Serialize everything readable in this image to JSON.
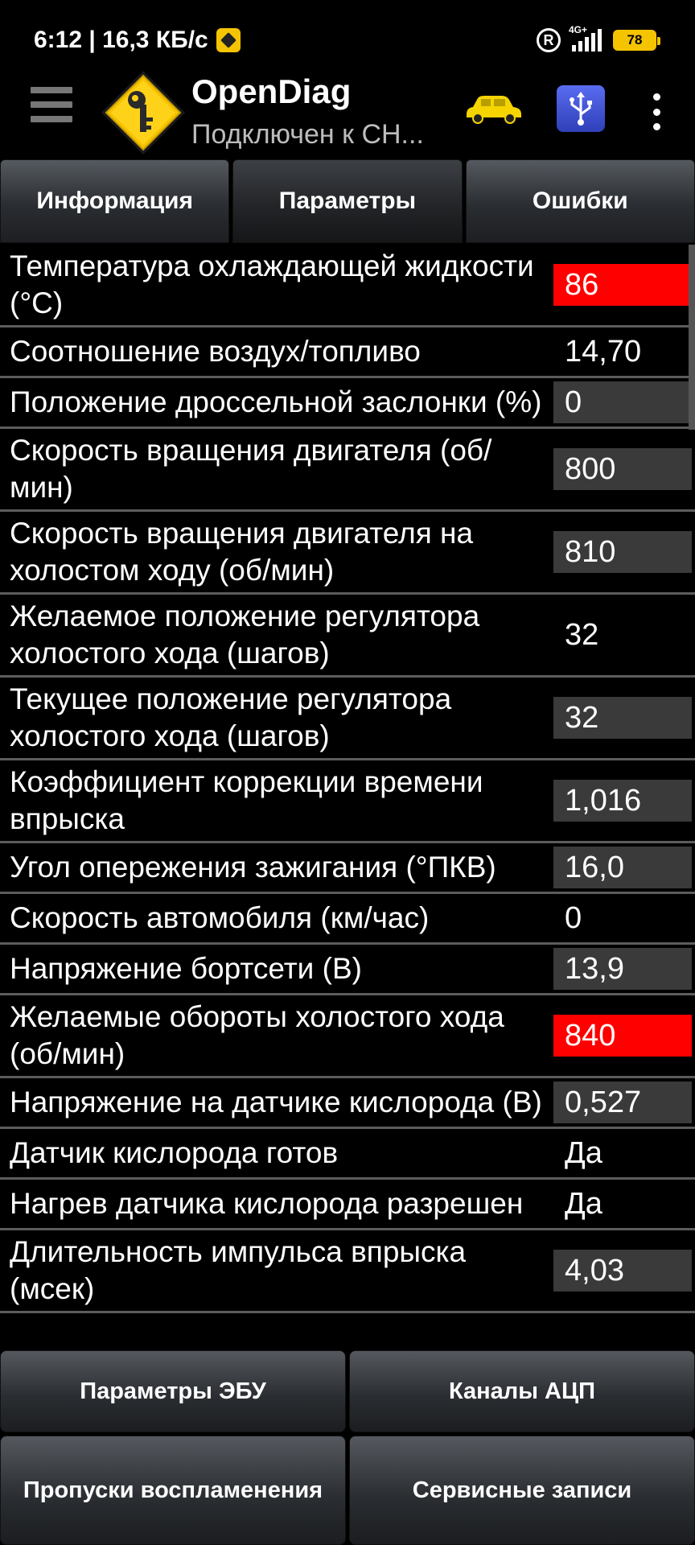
{
  "status_bar": {
    "time_speed": "6:12 | 16,3 КБ/с",
    "network_type": "4G+",
    "battery": "78",
    "registered_mark": "R"
  },
  "app_bar": {
    "title": "OpenDiag",
    "subtitle": "Подключен к СН...",
    "icons": [
      "menu-icon",
      "opendiag-logo-icon",
      "car-icon",
      "usb-icon",
      "more-icon"
    ]
  },
  "tabs": [
    {
      "label": "Информация",
      "active": false
    },
    {
      "label": "Параметры",
      "active": true
    },
    {
      "label": "Ошибки",
      "active": false
    }
  ],
  "params": [
    {
      "name": "Температура охлаждающей жидкости (°C)",
      "value": "86",
      "highlight": "red"
    },
    {
      "name": "Соотношение воздух/топливо",
      "value": "14,70",
      "highlight": "none"
    },
    {
      "name": "Положение дроссельной заслонки (%)",
      "value": "0",
      "highlight": "gray"
    },
    {
      "name": "Скорость вращения двигателя (об/мин)",
      "value": "800",
      "highlight": "gray"
    },
    {
      "name": "Скорость вращения двигателя на холостом ходу (об/мин)",
      "value": "810",
      "highlight": "gray"
    },
    {
      "name": "Желаемое положение регулятора холостого хода (шагов)",
      "value": "32",
      "highlight": "none"
    },
    {
      "name": "Текущее положение регулятора холостого хода (шагов)",
      "value": "32",
      "highlight": "gray"
    },
    {
      "name": "Коэффициент коррекции времени впрыска",
      "value": "1,016",
      "highlight": "gray"
    },
    {
      "name": "Угол опережения зажигания (°ПКВ)",
      "value": "16,0",
      "highlight": "gray"
    },
    {
      "name": "Скорость автомобиля (км/час)",
      "value": "0",
      "highlight": "none"
    },
    {
      "name": "Напряжение бортсети (В)",
      "value": "13,9",
      "highlight": "gray"
    },
    {
      "name": "Желаемые обороты холостого хода (об/мин)",
      "value": "840",
      "highlight": "red"
    },
    {
      "name": "Напряжение на датчике кислорода (В)",
      "value": "0,527",
      "highlight": "gray"
    },
    {
      "name": "Датчик кислорода готов",
      "value": "Да",
      "highlight": "none"
    },
    {
      "name": "Нагрев датчика кислорода разрешен",
      "value": "Да",
      "highlight": "none"
    },
    {
      "name": "Длительность импульса впрыска (мсек)",
      "value": "4,03",
      "highlight": "gray"
    }
  ],
  "bottom_buttons": [
    {
      "label": "Параметры ЭБУ"
    },
    {
      "label": "Каналы АЦП"
    },
    {
      "label": "Пропуски воспламенения"
    },
    {
      "label": "Сервисные записи"
    }
  ],
  "colors": {
    "background": "#000000",
    "value_red": "#ff0000",
    "value_gray": "#3a3a3a",
    "logo_yellow": "#f5c400",
    "usb_blue": "#3f52d6"
  }
}
